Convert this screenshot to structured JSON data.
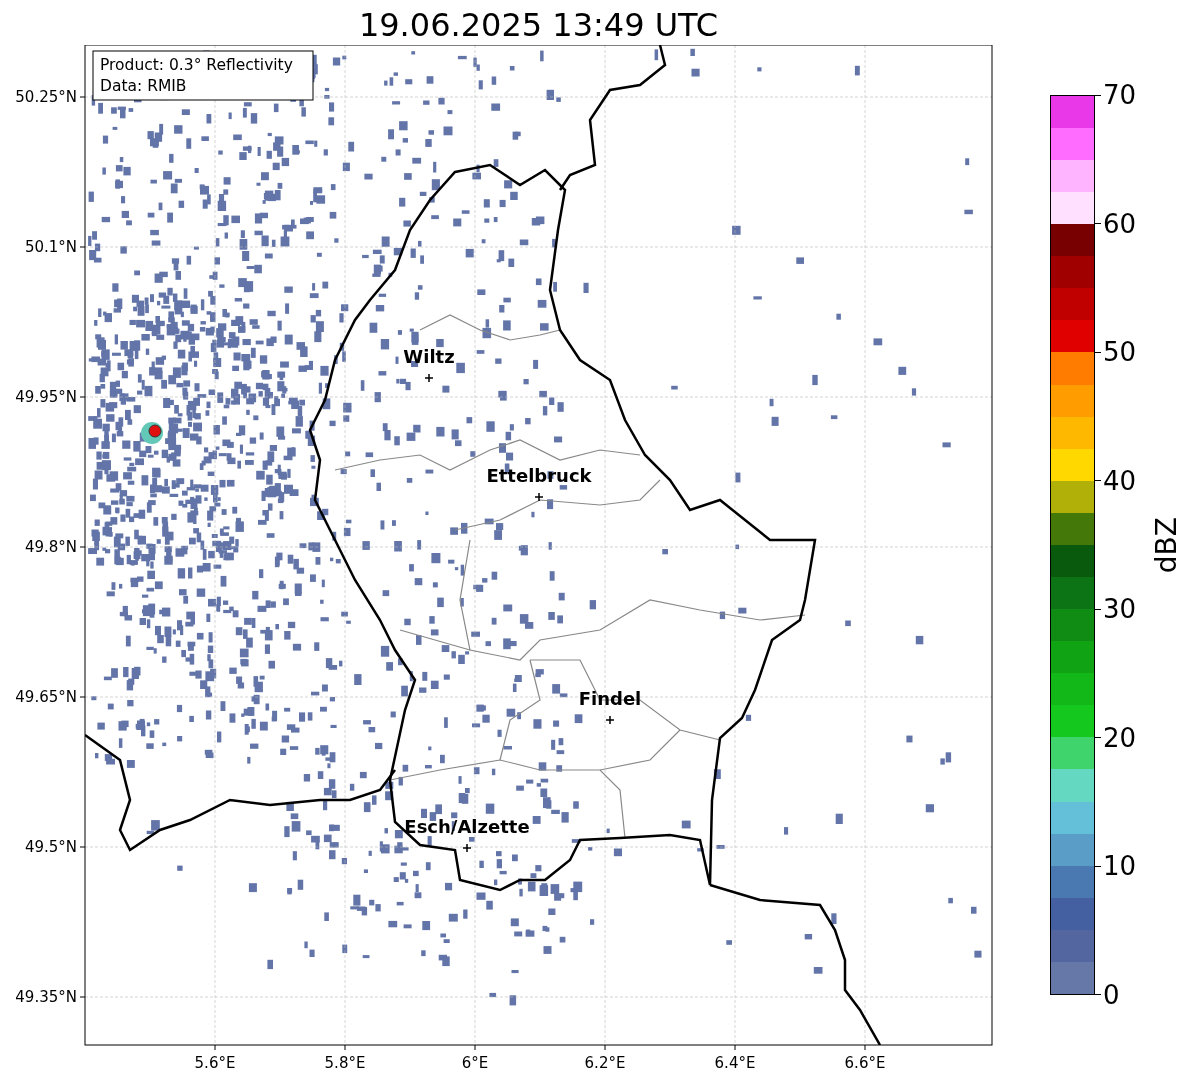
{
  "title": "19.06.2025 13:49 UTC",
  "info_box": [
    "Product: 0.3° Reflectivity",
    "Data: RMIB"
  ],
  "map": {
    "lat_ticks": [
      "50.25°N",
      "50.1°N",
      "49.95°N",
      "49.8°N",
      "49.65°N",
      "49.5°N",
      "49.35°N"
    ],
    "lon_ticks": [
      "5.6°E",
      "5.8°E",
      "6°E",
      "6.2°E",
      "6.4°E",
      "6.6°E"
    ],
    "cities": [
      {
        "name": "Wiltz"
      },
      {
        "name": "Ettelbruck"
      },
      {
        "name": "Findel"
      },
      {
        "name": "Esch/Alzette"
      }
    ]
  },
  "colorbar": {
    "label": "dBZ",
    "ticks": [
      "70",
      "60",
      "50",
      "40",
      "30",
      "20",
      "10",
      "0"
    ],
    "bands": [
      {
        "color": "#6678a8"
      },
      {
        "color": "#5466a0"
      },
      {
        "color": "#4560a0"
      },
      {
        "color": "#4a78b0"
      },
      {
        "color": "#5a9ec8"
      },
      {
        "color": "#64c0d8"
      },
      {
        "color": "#64d8c0"
      },
      {
        "color": "#40d46c"
      },
      {
        "color": "#14c81e"
      },
      {
        "color": "#12b818"
      },
      {
        "color": "#10a414"
      },
      {
        "color": "#108c14"
      },
      {
        "color": "#0c7414"
      },
      {
        "color": "#0a5a0e"
      },
      {
        "color": "#447808"
      },
      {
        "color": "#b0b008"
      },
      {
        "color": "#ffd800"
      },
      {
        "color": "#ffb800"
      },
      {
        "color": "#ff9c00"
      },
      {
        "color": "#ff7c00"
      },
      {
        "color": "#e00000"
      },
      {
        "color": "#c00000"
      },
      {
        "color": "#a00000"
      },
      {
        "color": "#780000"
      },
      {
        "color": "#ffe0ff"
      },
      {
        "color": "#ffb4ff"
      },
      {
        "color": "#ff6cff"
      },
      {
        "color": "#e838e8"
      }
    ]
  }
}
